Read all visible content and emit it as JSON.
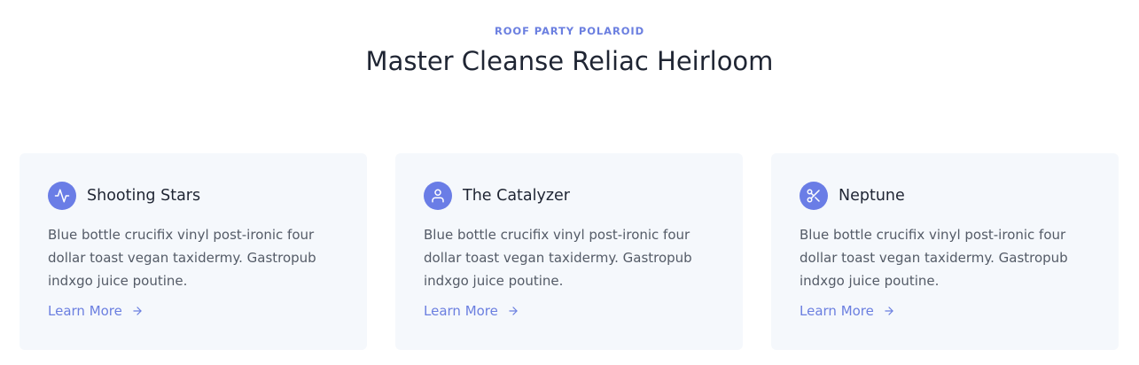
{
  "header": {
    "eyebrow": "ROOF PARTY POLAROID",
    "title": "Master Cleanse Reliac Heirloom"
  },
  "cards": [
    {
      "icon": "activity-icon",
      "title": "Shooting Stars",
      "text": "Blue bottle crucifix vinyl post-ironic four dollar toast vegan taxidermy. Gastropub indxgo juice poutine.",
      "link": "Learn More"
    },
    {
      "icon": "user-icon",
      "title": "The Catalyzer",
      "text": "Blue bottle crucifix vinyl post-ironic four dollar toast vegan taxidermy. Gastropub indxgo juice poutine.",
      "link": "Learn More"
    },
    {
      "icon": "scissors-icon",
      "title": "Neptune",
      "text": "Blue bottle crucifix vinyl post-ironic four dollar toast vegan taxidermy. Gastropub indxgo juice poutine.",
      "link": "Learn More"
    }
  ],
  "colors": {
    "accent": "#6a7de6",
    "card_bg": "#f5f8fc",
    "heading": "#1f2533",
    "body_text": "#545b67"
  }
}
